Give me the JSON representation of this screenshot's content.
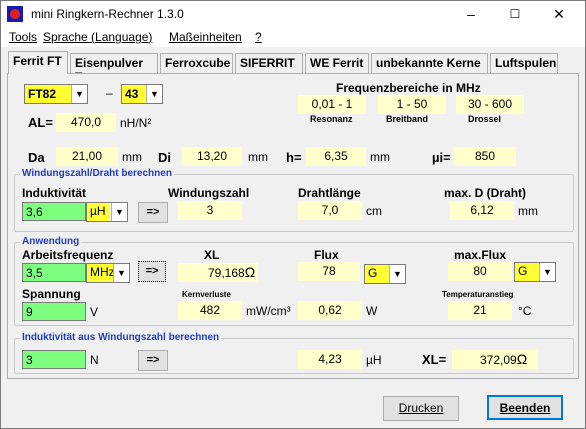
{
  "window": {
    "title": "mini Ringkern-Rechner 1.3.0",
    "min": "–",
    "max": "☐",
    "close": "✕"
  },
  "menu": [
    "Tools",
    "Sprache (Language)",
    "Maßeinheiten",
    "?"
  ],
  "tabs": [
    "Ferrit FT",
    "Eisenpulver T",
    "Ferroxcube",
    "SIFERRIT",
    "WE Ferrit",
    "unbekannte Kerne",
    "Luftspulen"
  ],
  "core": {
    "type_value": "FT82",
    "dash": "–",
    "material_value": "43",
    "al_label": "AL=",
    "al_value": "470,0",
    "al_unit": "nH/N²"
  },
  "freq": {
    "header": "Frequenzbereiche in MHz",
    "res_value": "0,01 - 1",
    "res_label": "Resonanz",
    "broad_value": "1 - 50",
    "broad_label": "Breitband",
    "choke_value": "30 - 600",
    "choke_label": "Drossel"
  },
  "dims": {
    "da_label": "Da",
    "da_value": "21,00",
    "da_unit": "mm",
    "di_label": "Di",
    "di_value": "13,20",
    "di_unit": "mm",
    "h_label": "h=",
    "h_value": "6,35",
    "h_unit": "mm",
    "mui_label": "µi=",
    "mui_value": "850"
  },
  "winding": {
    "title": "Windungszahl/Draht berechnen",
    "ind_label": "Induktivität",
    "ind_value": "3,6",
    "ind_unit": "µH",
    "arrow": "=>",
    "turns_label": "Windungszahl",
    "turns_value": "3",
    "wire_label": "Drahtlänge",
    "wire_value": "7,0",
    "wire_unit": "cm",
    "maxd_label": "max. D (Draht)",
    "maxd_value": "6,12",
    "maxd_unit": "mm"
  },
  "app": {
    "title": "Anwendung",
    "freq_label": "Arbeitsfrequenz",
    "freq_value": "3,5",
    "freq_unit": "MHz",
    "arrow": "=>",
    "xl_label": "XL",
    "xl_value": "79,168",
    "xl_unit": "Ω",
    "flux_label": "Flux",
    "flux_value": "78",
    "flux_unit": "G",
    "maxflux_label": "max.Flux",
    "maxflux_value": "80",
    "maxflux_unit": "G",
    "volt_label": "Spannung",
    "volt_value": "9",
    "volt_unit": "V",
    "loss_label": "Kernverluste",
    "loss_value": "482",
    "loss_unit": "mW/cm³",
    "w_value": "0,62",
    "w_unit": "W",
    "temp_label": "Temperaturanstieg",
    "temp_value": "21",
    "temp_unit": "°C"
  },
  "indcalc": {
    "title": "Induktivität aus Windungszahl berechnen",
    "n_value": "3",
    "n_unit": "N",
    "arrow": "=>",
    "l_value": "4,23",
    "l_unit": "µH",
    "xl_label": "XL=",
    "xl_value": "372,09",
    "xl_unit": "Ω"
  },
  "buttons": {
    "print": "Drucken",
    "exit": "Beenden"
  }
}
